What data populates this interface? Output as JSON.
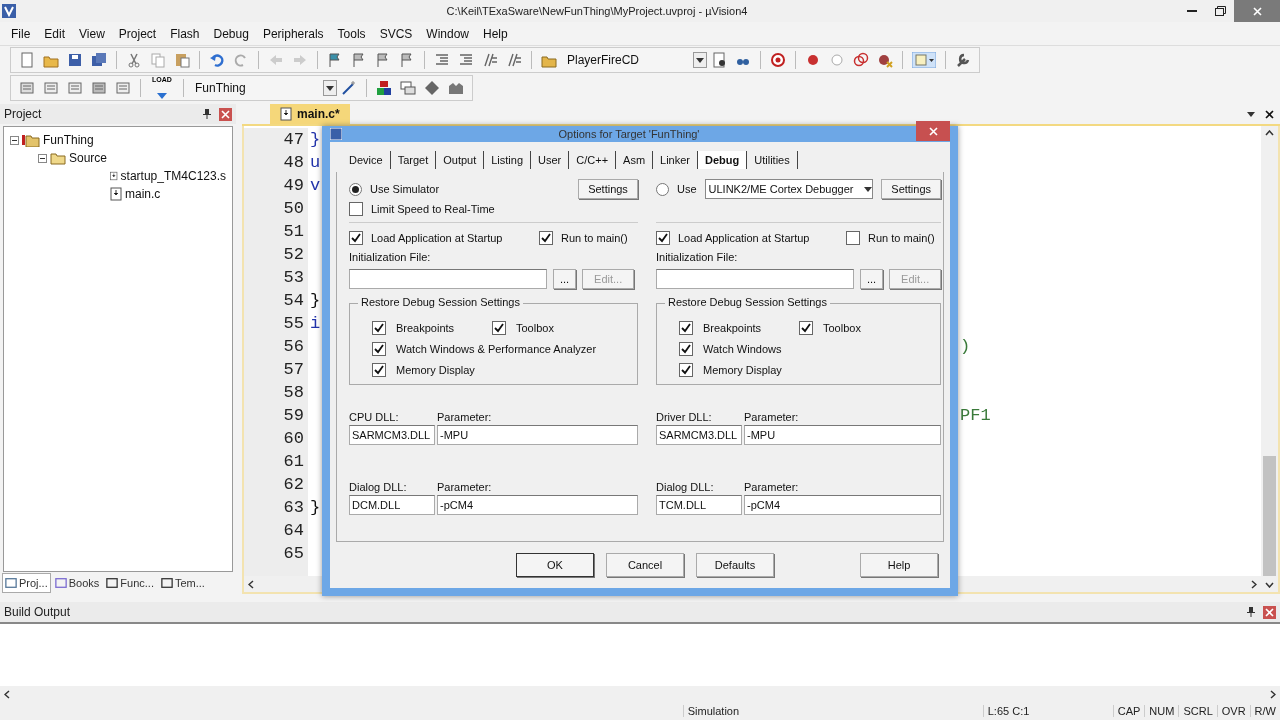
{
  "window": {
    "title": "C:\\Keil\\TExaSware\\NewFunThing\\MyProject.uvproj - µVision4"
  },
  "menu": [
    "File",
    "Edit",
    "View",
    "Project",
    "Flash",
    "Debug",
    "Peripherals",
    "Tools",
    "SVCS",
    "Window",
    "Help"
  ],
  "toolbar": {
    "find_combo": "PlayerFireCD",
    "target_combo": "FunThing",
    "load_label": "LOAD"
  },
  "project_panel": {
    "title": "Project",
    "tree": [
      {
        "label": "FunThing",
        "kind": "target",
        "expanded": true,
        "children": [
          {
            "label": "Source",
            "kind": "group",
            "expanded": true,
            "children": [
              {
                "label": "startup_TM4C123.s",
                "kind": "file"
              },
              {
                "label": "main.c",
                "kind": "file"
              }
            ]
          }
        ]
      }
    ],
    "tabs": [
      {
        "label": "Proj...",
        "selected": true
      },
      {
        "label": "Books",
        "selected": false
      },
      {
        "label": "Func...",
        "selected": false
      },
      {
        "label": "Tem...",
        "selected": false
      }
    ]
  },
  "editor": {
    "tab": "main.c*",
    "lines": [
      {
        "number": "47",
        "code": "}"
      },
      {
        "number": "48",
        "code": "u"
      },
      {
        "number": "49",
        "code": "v"
      },
      {
        "number": "50"
      },
      {
        "number": "51"
      },
      {
        "number": "52"
      },
      {
        "number": "53"
      },
      {
        "number": "54",
        "code": "}"
      },
      {
        "number": "55",
        "code": "i"
      },
      {
        "number": "56",
        "tail": ")"
      },
      {
        "number": "57"
      },
      {
        "number": "58"
      },
      {
        "number": "59",
        "tail": "PF1"
      },
      {
        "number": "60"
      },
      {
        "number": "61"
      },
      {
        "number": "62"
      },
      {
        "number": "63",
        "code": "}"
      },
      {
        "number": "64"
      },
      {
        "number": "65"
      }
    ]
  },
  "dialog": {
    "title": "Options for Target 'FunThing'",
    "tabs": [
      {
        "label": "Device",
        "selected": false
      },
      {
        "label": "Target",
        "selected": false
      },
      {
        "label": "Output",
        "selected": false
      },
      {
        "label": "Listing",
        "selected": false
      },
      {
        "label": "User",
        "selected": false
      },
      {
        "label": "C/C++",
        "selected": false
      },
      {
        "label": "Asm",
        "selected": false
      },
      {
        "label": "Linker",
        "selected": false
      },
      {
        "label": "Debug",
        "selected": true
      },
      {
        "label": "Utilities",
        "selected": false
      }
    ],
    "columns": [
      {
        "target": {
          "label": "Use Simulator",
          "selected": true
        },
        "settings": "Settings",
        "limit_speed": {
          "label": "Limit Speed to Real-Time",
          "checked": false
        },
        "load": {
          "label": "Load Application at Startup",
          "checked": true
        },
        "run_to_main": {
          "label": "Run to main()",
          "checked": true
        },
        "init_label": "Initialization File:",
        "browse": "...",
        "edit": {
          "label": "Edit...",
          "disabled": true
        },
        "restore": {
          "title": "Restore Debug Session Settings",
          "items": [
            {
              "label": "Breakpoints",
              "checked": true
            },
            {
              "label": "Toolbox",
              "checked": true
            },
            {
              "label": "Watch Windows & Performance Analyzer",
              "checked": true
            },
            {
              "label": "Memory Display",
              "checked": true
            }
          ]
        },
        "dll": {
          "label": "CPU DLL:",
          "value": "SARMCM3.DLL"
        },
        "dll_param": {
          "label": "Parameter:",
          "value": "-MPU"
        },
        "dialog_dll": {
          "label": "Dialog DLL:",
          "value": "DCM.DLL"
        },
        "dialog_param": {
          "label": "Parameter:",
          "value": "-pCM4"
        }
      },
      {
        "target": {
          "label": "Use",
          "selected": false
        },
        "debugger": "ULINK2/ME Cortex Debugger",
        "settings": "Settings",
        "load": {
          "label": "Load Application at Startup",
          "checked": true
        },
        "run_to_main": {
          "label": "Run to main()",
          "checked": false
        },
        "init_label": "Initialization File:",
        "browse": "...",
        "edit": {
          "label": "Edit...",
          "disabled": true
        },
        "restore": {
          "title": "Restore Debug Session Settings",
          "items": [
            {
              "label": "Breakpoints",
              "checked": true
            },
            {
              "label": "Toolbox",
              "checked": true
            },
            {
              "label": "Watch Windows",
              "checked": true
            },
            {
              "label": "Memory Display",
              "checked": true
            }
          ]
        },
        "dll": {
          "label": "Driver DLL:",
          "value": "SARMCM3.DLL"
        },
        "dll_param": {
          "label": "Parameter:",
          "value": "-MPU"
        },
        "dialog_dll": {
          "label": "Dialog DLL:",
          "value": "TCM.DLL"
        },
        "dialog_param": {
          "label": "Parameter:",
          "value": "-pCM4"
        }
      }
    ],
    "buttons": [
      {
        "label": "OK",
        "kind": "default"
      },
      {
        "label": "Cancel",
        "kind": "normal"
      },
      {
        "label": "Defaults",
        "kind": "normal"
      },
      {
        "label": "Help",
        "kind": "help"
      }
    ]
  },
  "build_output": {
    "title": "Build Output"
  },
  "status_bar": {
    "mode": "Simulation",
    "position": "L:65 C:1",
    "indicators": [
      "CAP",
      "NUM",
      "SCRL",
      "OVR",
      "R/W"
    ]
  }
}
